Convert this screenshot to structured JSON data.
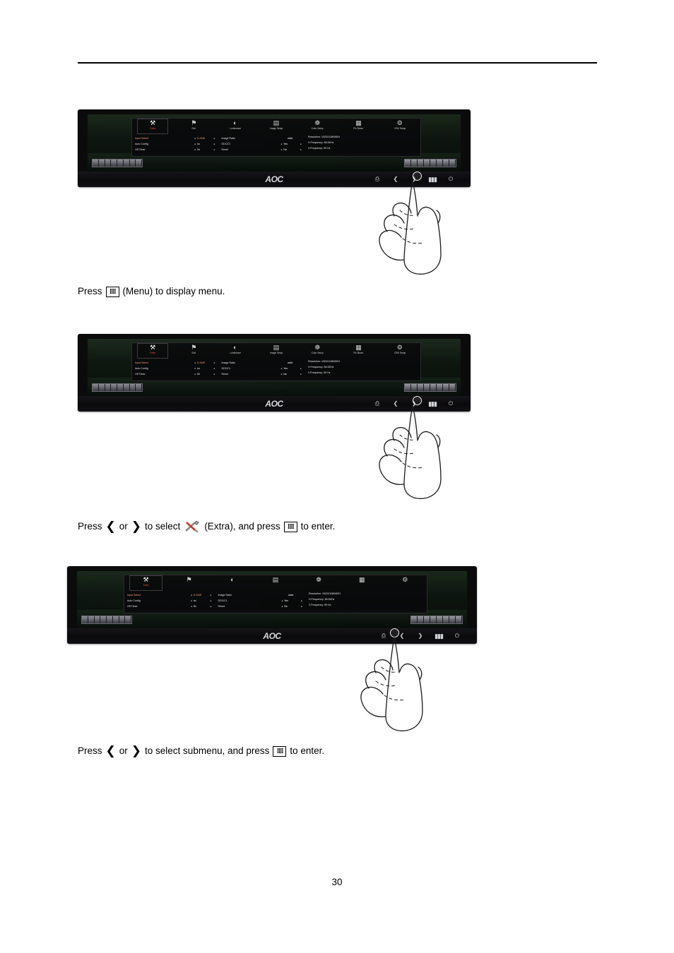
{
  "page": {
    "number": "30"
  },
  "osd": {
    "icons": [
      {
        "glyph": "⚒",
        "label": "Extra"
      },
      {
        "glyph": "⚑",
        "label": "Exit"
      },
      {
        "glyph": "◐",
        "label": "Luminance"
      },
      {
        "glyph": "▤",
        "label": "Image Setup"
      },
      {
        "glyph": "❁",
        "label": "Color Setup"
      },
      {
        "glyph": "▦",
        "label": "Pic Boost"
      },
      {
        "glyph": "⚙",
        "label": "OSD Setup"
      }
    ],
    "column1": [
      {
        "name": "Input Select",
        "value": "D-SUB"
      },
      {
        "name": "Auto Config",
        "value": "no"
      },
      {
        "name": "Off Timer",
        "value": "0h"
      }
    ],
    "column2_header": "Image Ratio",
    "column2": [
      {
        "name": "DDC/CI",
        "value": "Yes"
      },
      {
        "name": "Reset",
        "value": "No"
      }
    ],
    "column2_wide": "wide",
    "info": [
      "Resolution: 1920X1080/60H",
      "H.Frequency: 66.5KHz",
      "V.Frequency: 59 Hz"
    ]
  },
  "captions": {
    "step1": {
      "pre": "Press",
      "key": "IIII",
      "post": "(Menu) to display menu."
    },
    "step2": {
      "pre": "Press",
      "left": "❮",
      "or": "or",
      "right": "❯",
      "mid": "to select",
      "icon": "wrench-screwdriver-icon",
      "label": "(Extra), and press",
      "key": "IIII",
      "post": "to enter."
    },
    "step3": {
      "pre": "Press",
      "left": "❮",
      "or": "or",
      "right": "❯",
      "mid": "to select submenu, and press",
      "key": "IIII",
      "post": "to enter."
    }
  },
  "monitor": {
    "brand": "AOC",
    "buttons": [
      {
        "name": "source-button",
        "glyph": "↺"
      },
      {
        "name": "left-button",
        "glyph": "❮"
      },
      {
        "name": "right-button",
        "glyph": "❯"
      },
      {
        "name": "menu-button",
        "glyph": "IIII"
      },
      {
        "name": "power-button",
        "glyph": "⏻"
      }
    ]
  },
  "figures": [
    {
      "highlight": "menu-button"
    },
    {
      "highlight": "menu-button"
    },
    {
      "highlight": "right-button"
    }
  ]
}
